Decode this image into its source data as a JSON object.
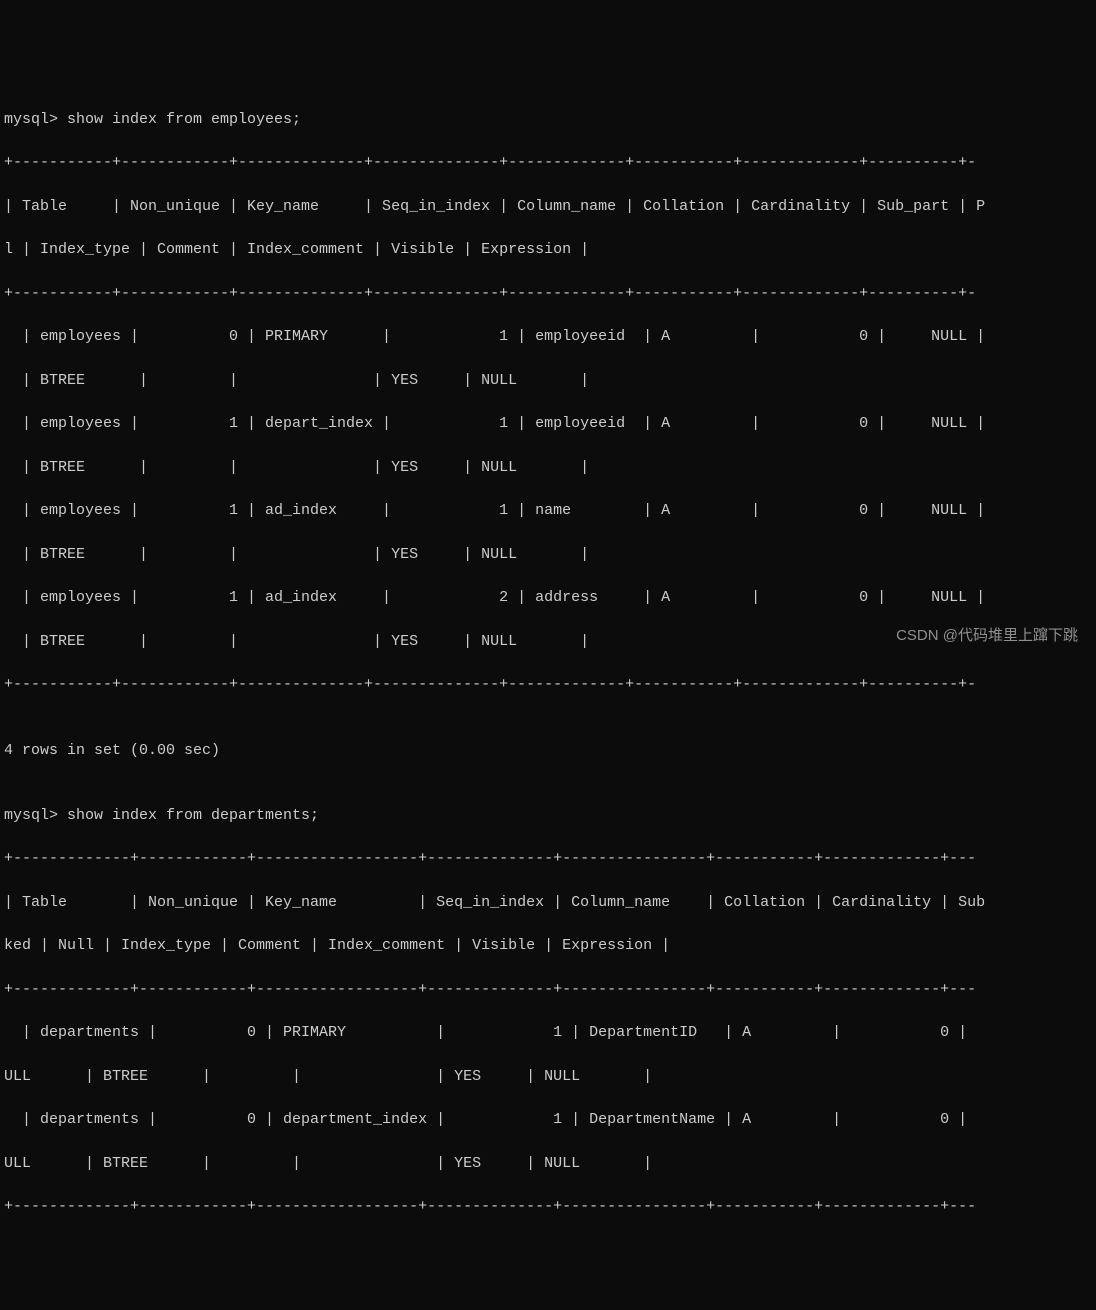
{
  "lines": {
    "l0": "mysql> show index from employees;",
    "l1": "+-----------+------------+--------------+--------------+-------------+-----------+-------------+----------+-",
    "l2": "| Table     | Non_unique | Key_name     | Seq_in_index | Column_name | Collation | Cardinality | Sub_part | P",
    "l3": "l | Index_type | Comment | Index_comment | Visible | Expression |",
    "l4": "+-----------+------------+--------------+--------------+-------------+-----------+-------------+----------+-",
    "l5": "  | employees |          0 | PRIMARY      |            1 | employeeid  | A         |           0 |     NULL |",
    "l6": "  | BTREE      |         |               | YES     | NULL       |",
    "l7": "  | employees |          1 | depart_index |            1 | employeeid  | A         |           0 |     NULL |",
    "l8": "  | BTREE      |         |               | YES     | NULL       |",
    "l9": "  | employees |          1 | ad_index     |            1 | name        | A         |           0 |     NULL |",
    "l10": "  | BTREE      |         |               | YES     | NULL       |",
    "l11": "  | employees |          1 | ad_index     |            2 | address     | A         |           0 |     NULL |",
    "l12": "  | BTREE      |         |               | YES     | NULL       |",
    "l13": "+-----------+------------+--------------+--------------+-------------+-----------+-------------+----------+-",
    "l14": "",
    "l15": "4 rows in set (0.00 sec)",
    "l16": "",
    "l17": "mysql> show index from departments;",
    "l18": "+-------------+------------+------------------+--------------+----------------+-----------+-------------+---",
    "l19": "| Table       | Non_unique | Key_name         | Seq_in_index | Column_name    | Collation | Cardinality | Sub",
    "l20": "ked | Null | Index_type | Comment | Index_comment | Visible | Expression |",
    "l21": "+-------------+------------+------------------+--------------+----------------+-----------+-------------+---",
    "l22": "  | departments |          0 | PRIMARY          |            1 | DepartmentID   | A         |           0 |",
    "l23": "ULL      | BTREE      |         |               | YES     | NULL       |",
    "l24": "  | departments |          0 | department_index |            1 | DepartmentName | A         |           0 |",
    "l25": "ULL      | BTREE      |         |               | YES     | NULL       |",
    "l26": "+-------------+------------+------------------+--------------+----------------+-----------+-------------+---"
  },
  "watermark": "CSDN @代码堆里上蹿下跳",
  "chart_data": {
    "type": "table",
    "tables": [
      {
        "query": "show index from employees;",
        "columns": [
          "Table",
          "Non_unique",
          "Key_name",
          "Seq_in_index",
          "Column_name",
          "Collation",
          "Cardinality",
          "Sub_part",
          "Packed",
          "Null",
          "Index_type",
          "Comment",
          "Index_comment",
          "Visible",
          "Expression"
        ],
        "rows": [
          {
            "Table": "employees",
            "Non_unique": 0,
            "Key_name": "PRIMARY",
            "Seq_in_index": 1,
            "Column_name": "employeeid",
            "Collation": "A",
            "Cardinality": 0,
            "Sub_part": "NULL",
            "Index_type": "BTREE",
            "Visible": "YES",
            "Expression": "NULL"
          },
          {
            "Table": "employees",
            "Non_unique": 1,
            "Key_name": "depart_index",
            "Seq_in_index": 1,
            "Column_name": "employeeid",
            "Collation": "A",
            "Cardinality": 0,
            "Sub_part": "NULL",
            "Index_type": "BTREE",
            "Visible": "YES",
            "Expression": "NULL"
          },
          {
            "Table": "employees",
            "Non_unique": 1,
            "Key_name": "ad_index",
            "Seq_in_index": 1,
            "Column_name": "name",
            "Collation": "A",
            "Cardinality": 0,
            "Sub_part": "NULL",
            "Index_type": "BTREE",
            "Visible": "YES",
            "Expression": "NULL"
          },
          {
            "Table": "employees",
            "Non_unique": 1,
            "Key_name": "ad_index",
            "Seq_in_index": 2,
            "Column_name": "address",
            "Collation": "A",
            "Cardinality": 0,
            "Sub_part": "NULL",
            "Index_type": "BTREE",
            "Visible": "YES",
            "Expression": "NULL"
          }
        ],
        "footer": "4 rows in set (0.00 sec)"
      },
      {
        "query": "show index from departments;",
        "columns": [
          "Table",
          "Non_unique",
          "Key_name",
          "Seq_in_index",
          "Column_name",
          "Collation",
          "Cardinality",
          "Sub_part",
          "Packed",
          "Null",
          "Index_type",
          "Comment",
          "Index_comment",
          "Visible",
          "Expression"
        ],
        "rows": [
          {
            "Table": "departments",
            "Non_unique": 0,
            "Key_name": "PRIMARY",
            "Seq_in_index": 1,
            "Column_name": "DepartmentID",
            "Collation": "A",
            "Cardinality": 0,
            "Sub_part": "NULL",
            "Index_type": "BTREE",
            "Visible": "YES",
            "Expression": "NULL"
          },
          {
            "Table": "departments",
            "Non_unique": 0,
            "Key_name": "department_index",
            "Seq_in_index": 1,
            "Column_name": "DepartmentName",
            "Collation": "A",
            "Cardinality": 0,
            "Sub_part": "NULL",
            "Index_type": "BTREE",
            "Visible": "YES",
            "Expression": "NULL"
          }
        ]
      }
    ]
  }
}
